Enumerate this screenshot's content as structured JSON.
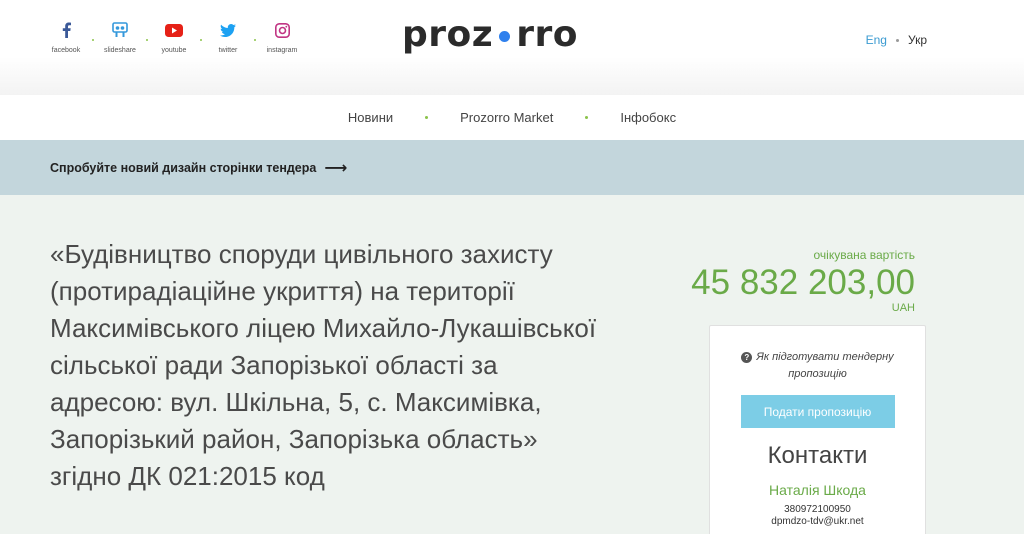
{
  "social": [
    {
      "icon": "facebook-icon",
      "label": "facebook",
      "color": "#3b5998"
    },
    {
      "icon": "slideshare-icon",
      "label": "slideshare",
      "color": "#3498db"
    },
    {
      "icon": "youtube-icon",
      "label": "youtube",
      "color": "#e62117"
    },
    {
      "icon": "twitter-icon",
      "label": "twitter",
      "color": "#1da1f2"
    },
    {
      "icon": "instagram-icon",
      "label": "instagram",
      "color": "#c13584"
    }
  ],
  "logo": {
    "part1": "proz",
    "part2": "rro",
    "dot_color": "#2f80ed"
  },
  "lang": {
    "eng": "Eng",
    "ukr": "Укр"
  },
  "nav": {
    "news": "Новини",
    "market": "Prozorro Market",
    "infobox": "Інфобокс"
  },
  "banner": {
    "text": "Спробуйте новий дизайн сторінки тендера",
    "arrow": "⟶"
  },
  "tender": {
    "title": "«Будівництво споруди цивільного захисту (протирадіаційне укриття) на території Максимівського ліцею Михайло-Лукашівської сільської ради Запорізької області за адресою: вул. Шкільна, 5, с. Максимівка, Запорізький район, Запорізька область» згідно ДК 021:2015 код"
  },
  "value": {
    "label": "очікувана вартість",
    "amount": "45 832 203,00",
    "currency": "UAH",
    "color": "#6aaa48"
  },
  "card": {
    "help_text": "Як підготувати тендерну пропозицію",
    "submit_label": "Подати пропозицію",
    "contacts_heading": "Контакти",
    "contact_name": "Наталія Шкода",
    "contact_phone": "380972100950",
    "contact_email": "dpmdzo-tdv@ukr.net"
  }
}
